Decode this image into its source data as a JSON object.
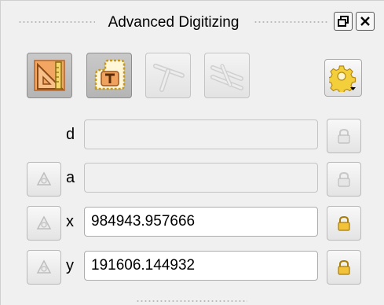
{
  "panel": {
    "title": "Advanced Digitizing"
  },
  "titlebar_buttons": [
    {
      "name": "float-button",
      "icon": "restore-window-icon"
    },
    {
      "name": "close-button",
      "icon": "close-icon"
    }
  ],
  "toolbar": {
    "buttons": [
      {
        "name": "enable-advanced-digitizing",
        "icon": "set-square-ruler-icon",
        "state": "checked"
      },
      {
        "name": "construction-mode",
        "icon": "construction-mode-icon",
        "state": "checked"
      },
      {
        "name": "perpendicular",
        "icon": "perpendicular-icon",
        "state": "disabled"
      },
      {
        "name": "parallel",
        "icon": "parallel-icon",
        "state": "disabled"
      }
    ],
    "settings": {
      "icon": "gear-icon",
      "has_dropdown": true
    }
  },
  "fields": [
    {
      "key": "d",
      "label": "d",
      "value": "",
      "enabled": false,
      "has_relative": false,
      "locked": false
    },
    {
      "key": "a",
      "label": "a",
      "value": "",
      "enabled": false,
      "has_relative": true,
      "locked": false
    },
    {
      "key": "x",
      "label": "x",
      "value": "984943.957666",
      "enabled": true,
      "has_relative": true,
      "locked": false
    },
    {
      "key": "y",
      "label": "y",
      "value": "191606.144932",
      "enabled": true,
      "has_relative": true,
      "locked": false
    }
  ],
  "colors": {
    "panel_bg": "#f0f0f0",
    "accent_orange": "#f0a35e",
    "lock_enabled": "#f2c33a",
    "disabled_icon": "#bdbdbd"
  }
}
